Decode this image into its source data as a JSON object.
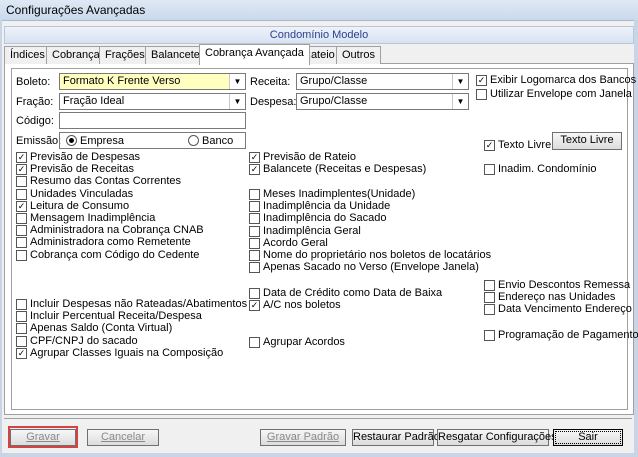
{
  "window": {
    "title": "Configurações Avançadas"
  },
  "header": {
    "title": "Condomínio Modelo"
  },
  "tabs": [
    {
      "label": "Índices"
    },
    {
      "label": "Cobrança"
    },
    {
      "label": "Frações"
    },
    {
      "label": "Balancete"
    },
    {
      "label": "Cobrança Avançada",
      "active": true
    },
    {
      "label": "Rateio"
    },
    {
      "label": "Outros"
    }
  ],
  "form": {
    "boleto_label": "Boleto:",
    "boleto_value": "Formato K Frente Verso",
    "fracao_label": "Fração:",
    "fracao_value": "Fração Ideal",
    "codigo_label": "Código:",
    "codigo_value": "",
    "emissao_label": "Emissão:",
    "emissao_empresa": "Empresa",
    "emissao_banco": "Banco",
    "emissao_selected": "Empresa",
    "receita_label": "Receita:",
    "receita_value": "Grupo/Classe",
    "despesa_label": "Despesa:",
    "despesa_value": "Grupo/Classe"
  },
  "right_top": {
    "exibir_logomarca": {
      "label": "Exibir Logomarca dos Bancos",
      "checked": true
    },
    "utilizar_envelope": {
      "label": "Utilizar Envelope com Janela",
      "checked": false
    },
    "texto_livre": {
      "label": "Texto Livre",
      "checked": true
    },
    "texto_livre_button": "Texto Livre",
    "inadim_condominio": {
      "label": "Inadim. Condomínio",
      "checked": false
    }
  },
  "left_checks": [
    {
      "label": "Previsão de Despesas",
      "checked": true
    },
    {
      "label": "Previsão de Receitas",
      "checked": true
    },
    {
      "label": "Resumo das Contas Correntes",
      "checked": false
    },
    {
      "label": "Unidades Vinculadas",
      "checked": false
    },
    {
      "label": "Leitura de Consumo",
      "checked": true
    },
    {
      "label": "Mensagem Inadimplência",
      "checked": false
    },
    {
      "label": "Administradora na Cobrança CNAB",
      "checked": false
    },
    {
      "label": "Administradora como Remetente",
      "checked": false
    },
    {
      "label": "Cobrança com Código do Cedente",
      "checked": false
    }
  ],
  "left_checks_bottom": [
    {
      "label": "Incluir Despesas não Rateadas/Abatimentos",
      "checked": false
    },
    {
      "label": "Incluir Percentual Receita/Despesa",
      "checked": false
    },
    {
      "label": "Apenas Saldo (Conta Virtual)",
      "checked": false
    },
    {
      "label": "CPF/CNPJ do sacado",
      "checked": false
    },
    {
      "label": "Agrupar Classes Iguais na Composição",
      "checked": true
    }
  ],
  "mid_checks": [
    {
      "label": "Previsão de Rateio",
      "checked": true
    },
    {
      "label": "Balancete (Receitas e Despesas)",
      "checked": true
    }
  ],
  "mid_checks_2": [
    {
      "label": "Meses Inadimplentes(Unidade)",
      "checked": false
    },
    {
      "label": "Inadimplência da Unidade",
      "checked": false
    },
    {
      "label": "Inadimplência do Sacado",
      "checked": false
    },
    {
      "label": "Inadimplência Geral",
      "checked": false
    },
    {
      "label": "Acordo Geral",
      "checked": false
    },
    {
      "label": "Nome do proprietário nos boletos de locatários",
      "checked": false
    },
    {
      "label": "Apenas Sacado no Verso (Envelope Janela)",
      "checked": false
    }
  ],
  "mid_checks_3": [
    {
      "label": "Data de Crédito como Data de Baixa",
      "checked": false
    },
    {
      "label": "A/C nos boletos",
      "checked": true
    }
  ],
  "mid_agrupar": {
    "label": "Agrupar Acordos",
    "checked": false
  },
  "right_checks": [
    {
      "label": "Envio Descontos Remessa",
      "checked": false
    },
    {
      "label": "Endereço nas Unidades",
      "checked": false
    },
    {
      "label": "Data Vencimento Endereço",
      "checked": false
    }
  ],
  "right_programacao": {
    "label": "Programação de Pagamento",
    "checked": false
  },
  "buttons": {
    "gravar": "Gravar",
    "cancelar": "Cancelar",
    "gravar_padrao": "Gravar Padrão",
    "restaurar_padrao": "Restaurar Padrão",
    "resgatar_configuracoes": "Resgatar Configurações",
    "sair": "Sair"
  },
  "colors": {
    "highlight": "#d24343",
    "header_text": "#2c3f8f",
    "boleto_bg": "#ffffc0"
  }
}
